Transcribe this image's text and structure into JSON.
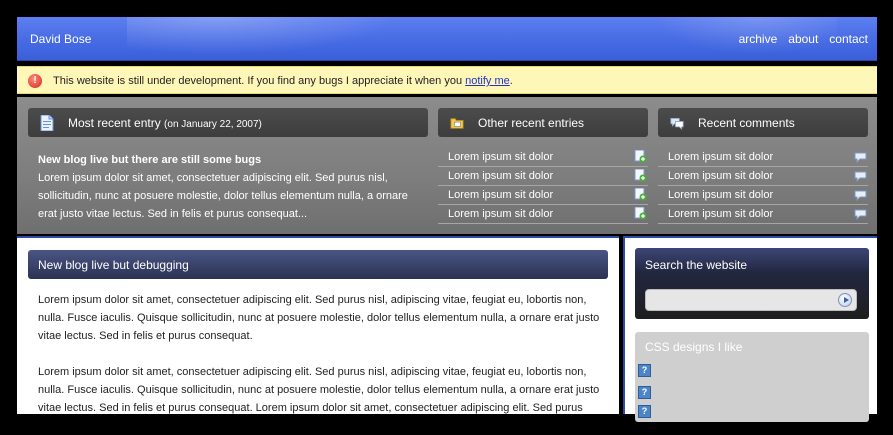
{
  "header": {
    "site_title": "David Bose",
    "nav": [
      "archive",
      "about",
      "contact"
    ]
  },
  "notice": {
    "icon": "warning-icon",
    "text": "This website is still under development. If you find any bugs I appreciate it when you ",
    "link": "notify me",
    "suffix": "."
  },
  "recent": {
    "heading": "Most recent entry ",
    "date": "(on January 22, 2007)",
    "post_title": "New blog live but there are still some bugs",
    "excerpt": "Lorem ipsum dolor sit amet, consectetuer adipiscing elit. Sed purus nisl, sollicitudin, nunc at posuere molestie, dolor tellus elementum nulla, a ornare erat justo vitae lectus. Sed in felis et purus consequat..."
  },
  "other_entries": {
    "heading": "Other recent entries",
    "items": [
      "Lorem ipsum sit dolor",
      "Lorem ipsum sit dolor",
      "Lorem ipsum sit dolor",
      "Lorem ipsum sit dolor"
    ]
  },
  "comments": {
    "heading": "Recent comments",
    "items": [
      "Lorem ipsum sit dolor",
      "Lorem ipsum sit dolor",
      "Lorem ipsum sit dolor",
      "Lorem ipsum sit dolor"
    ]
  },
  "main": {
    "title": "New blog live but debugging",
    "paragraph1": "Lorem ipsum dolor sit amet, consectetuer adipiscing elit. Sed purus nisl, adipiscing vitae, feugiat eu, lobortis non, nulla. Fusce iaculis. Quisque sollicitudin, nunc at posuere molestie, dolor tellus elementum nulla, a ornare erat justo vitae lectus. Sed in felis et purus consequat.",
    "paragraph2": "Lorem ipsum dolor sit amet, consectetuer adipiscing elit. Sed purus nisl, adipiscing vitae, feugiat eu, lobortis non, nulla. Fusce iaculis. Quisque sollicitudin, nunc at posuere molestie, dolor tellus elementum nulla, a ornare erat justo vitae lectus. Sed in felis et purus consequat. Lorem ipsum dolor sit amet, consectetuer adipiscing elit. Sed purus"
  },
  "sidebar": {
    "search_title": "Search the website",
    "css_title": "CSS designs I like"
  }
}
